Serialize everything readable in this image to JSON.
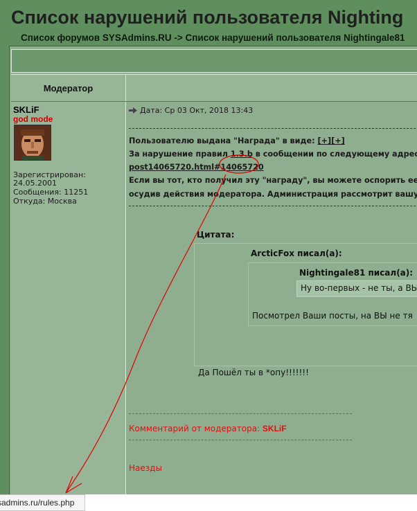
{
  "page": {
    "title": "Список нарушений пользователя Nighting",
    "breadcrumb_home": "Список форумов SYSAdmins.RU",
    "breadcrumb_sep": " -> ",
    "breadcrumb_current": "Список нарушений пользователя Nightingale81"
  },
  "table": {
    "header_author": "Модератор"
  },
  "author": {
    "name": "SKLiF",
    "rank": "god mode",
    "registered": "Зарегистрирован:",
    "registered_date": "24.05.2001",
    "posts": "Сообщения: 11251",
    "location": "Откуда: Москва"
  },
  "post": {
    "date": "Дата: Ср 03 Окт, 2018 13:43",
    "award_prefix": "Пользователю выдана \"Награда\" в виде: ",
    "award_plus1": "[+]",
    "award_plus2": "[+]",
    "rule_prefix": "За нарушение правил ",
    "rule_link": "1.3.b",
    "rule_suffix": " в сообщении по следующему адресу:",
    "post_link": "post14065720.html#14065720",
    "contest_line": "Если вы тот, кто получил эту \"награду\", вы можете оспорить ее,",
    "admin_line": "осудив действия модератора. Администрация рассмотрит вашу ж",
    "quote_label": "Цитата:",
    "quote_author_1": "ArcticFox писал(а):",
    "quote_author_2": "Nightingale81 писал(а):",
    "quote_text_deep": "Ну во-первых - не ты, а ВЫ!",
    "quote_text_mid": "Посмотрел Ваши посты, на ВЫ не тя",
    "reply_text": "Да Пошёл ты в *опу!!!!!!!",
    "mod_comment_label": "Комментарий от модератора: ",
    "mod_comment_name": "SKLiF",
    "mod_comment_text": "Наезды"
  },
  "status": {
    "url": "ysadmins.ru/rules.php"
  },
  "colors": {
    "background": "#5f8f5f",
    "panel": "#8fad8f",
    "accent_red": "#d40000"
  }
}
